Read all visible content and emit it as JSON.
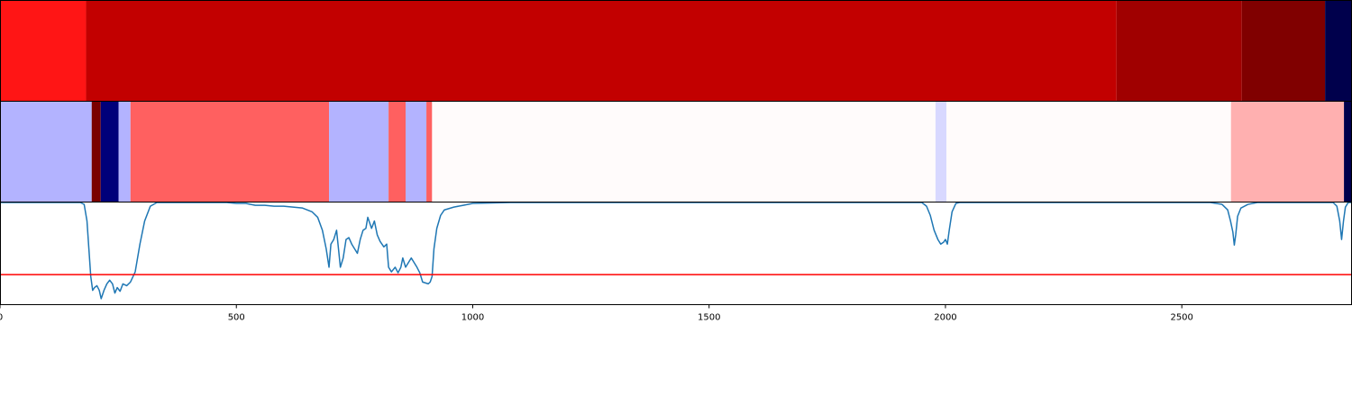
{
  "chart_data": {
    "type": "heatmap",
    "x_range": [
      0,
      2860
    ],
    "x_ticks": [
      0,
      500,
      1000,
      1500,
      2000,
      2500
    ],
    "x_tick_labels": [
      "0",
      "500",
      "1000",
      "1500",
      "2000",
      "2500"
    ],
    "grid": false,
    "legend": "none",
    "tracks": [
      {
        "type": "heatmap",
        "segments": [
          {
            "start": 0,
            "end": 182,
            "color": "#ff1515"
          },
          {
            "start": 182,
            "end": 2362,
            "color": "#c20000"
          },
          {
            "start": 2362,
            "end": 2627,
            "color": "#a00000"
          },
          {
            "start": 2627,
            "end": 2803,
            "color": "#800000"
          },
          {
            "start": 2803,
            "end": 2860,
            "color": "#00004c"
          }
        ]
      },
      {
        "type": "heatmap",
        "segments": [
          {
            "start": 0,
            "end": 194,
            "color": "#b3b3ff"
          },
          {
            "start": 194,
            "end": 213,
            "color": "#7a0000"
          },
          {
            "start": 213,
            "end": 251,
            "color": "#00007a"
          },
          {
            "start": 251,
            "end": 276,
            "color": "#b3b3ff"
          },
          {
            "start": 276,
            "end": 696,
            "color": "#ff6060"
          },
          {
            "start": 696,
            "end": 822,
            "color": "#b3b3ff"
          },
          {
            "start": 822,
            "end": 858,
            "color": "#ff6060"
          },
          {
            "start": 858,
            "end": 902,
            "color": "#b3b3ff"
          },
          {
            "start": 902,
            "end": 914,
            "color": "#ff6060"
          },
          {
            "start": 914,
            "end": 1979,
            "color": "#fffbfb"
          },
          {
            "start": 1979,
            "end": 2002,
            "color": "#d8d8ff"
          },
          {
            "start": 2002,
            "end": 2604,
            "color": "#fffbfb"
          },
          {
            "start": 2604,
            "end": 2843,
            "color": "#ffb0b0"
          },
          {
            "start": 2843,
            "end": 2860,
            "color": "#00004c"
          }
        ]
      },
      {
        "type": "line",
        "y_range": [
          -0.1,
          1.0
        ],
        "threshold": 0.22,
        "series": [
          {
            "color": "#1f77b4",
            "points": [
              [
                0,
                1.0
              ],
              [
                170,
                1.0
              ],
              [
                178,
                0.98
              ],
              [
                184,
                0.8
              ],
              [
                188,
                0.5
              ],
              [
                192,
                0.2
              ],
              [
                196,
                0.05
              ],
              [
                200,
                0.08
              ],
              [
                205,
                0.1
              ],
              [
                210,
                0.05
              ],
              [
                214,
                -0.04
              ],
              [
                220,
                0.05
              ],
              [
                226,
                0.12
              ],
              [
                232,
                0.16
              ],
              [
                238,
                0.12
              ],
              [
                243,
                0.02
              ],
              [
                248,
                0.08
              ],
              [
                254,
                0.04
              ],
              [
                260,
                0.12
              ],
              [
                268,
                0.1
              ],
              [
                276,
                0.14
              ],
              [
                286,
                0.25
              ],
              [
                296,
                0.55
              ],
              [
                306,
                0.8
              ],
              [
                318,
                0.96
              ],
              [
                332,
                1.0
              ],
              [
                480,
                1.0
              ],
              [
                500,
                0.99
              ],
              [
                520,
                0.99
              ],
              [
                540,
                0.97
              ],
              [
                560,
                0.97
              ],
              [
                580,
                0.96
              ],
              [
                600,
                0.96
              ],
              [
                620,
                0.95
              ],
              [
                640,
                0.94
              ],
              [
                660,
                0.9
              ],
              [
                672,
                0.84
              ],
              [
                682,
                0.7
              ],
              [
                690,
                0.5
              ],
              [
                696,
                0.3
              ],
              [
                700,
                0.55
              ],
              [
                706,
                0.6
              ],
              [
                712,
                0.7
              ],
              [
                716,
                0.5
              ],
              [
                720,
                0.3
              ],
              [
                726,
                0.4
              ],
              [
                732,
                0.6
              ],
              [
                738,
                0.62
              ],
              [
                744,
                0.55
              ],
              [
                750,
                0.5
              ],
              [
                756,
                0.45
              ],
              [
                762,
                0.6
              ],
              [
                768,
                0.7
              ],
              [
                774,
                0.72
              ],
              [
                778,
                0.84
              ],
              [
                786,
                0.72
              ],
              [
                792,
                0.8
              ],
              [
                798,
                0.65
              ],
              [
                804,
                0.58
              ],
              [
                812,
                0.52
              ],
              [
                818,
                0.55
              ],
              [
                822,
                0.3
              ],
              [
                828,
                0.25
              ],
              [
                836,
                0.3
              ],
              [
                842,
                0.24
              ],
              [
                848,
                0.3
              ],
              [
                852,
                0.4
              ],
              [
                858,
                0.3
              ],
              [
                864,
                0.35
              ],
              [
                870,
                0.4
              ],
              [
                876,
                0.35
              ],
              [
                882,
                0.3
              ],
              [
                888,
                0.24
              ],
              [
                894,
                0.14
              ],
              [
                900,
                0.13
              ],
              [
                906,
                0.12
              ],
              [
                910,
                0.14
              ],
              [
                914,
                0.2
              ],
              [
                918,
                0.5
              ],
              [
                924,
                0.72
              ],
              [
                932,
                0.86
              ],
              [
                940,
                0.92
              ],
              [
                960,
                0.95
              ],
              [
                980,
                0.97
              ],
              [
                1000,
                0.99
              ],
              [
                1080,
                1.0
              ],
              [
                1950,
                1.0
              ],
              [
                1960,
                0.96
              ],
              [
                1968,
                0.86
              ],
              [
                1976,
                0.7
              ],
              [
                1984,
                0.6
              ],
              [
                1990,
                0.55
              ],
              [
                1996,
                0.57
              ],
              [
                2000,
                0.6
              ],
              [
                2004,
                0.55
              ],
              [
                2008,
                0.7
              ],
              [
                2014,
                0.9
              ],
              [
                2022,
                0.99
              ],
              [
                2030,
                1.0
              ],
              [
                2560,
                1.0
              ],
              [
                2585,
                0.98
              ],
              [
                2597,
                0.92
              ],
              [
                2603,
                0.8
              ],
              [
                2608,
                0.68
              ],
              [
                2611,
                0.54
              ],
              [
                2614,
                0.65
              ],
              [
                2618,
                0.85
              ],
              [
                2625,
                0.94
              ],
              [
                2640,
                0.98
              ],
              [
                2660,
                1.0
              ],
              [
                2820,
                1.0
              ],
              [
                2828,
                0.96
              ],
              [
                2834,
                0.8
              ],
              [
                2838,
                0.6
              ],
              [
                2842,
                0.8
              ],
              [
                2846,
                0.95
              ],
              [
                2852,
                1.0
              ],
              [
                2860,
                1.0
              ]
            ]
          }
        ]
      }
    ]
  }
}
